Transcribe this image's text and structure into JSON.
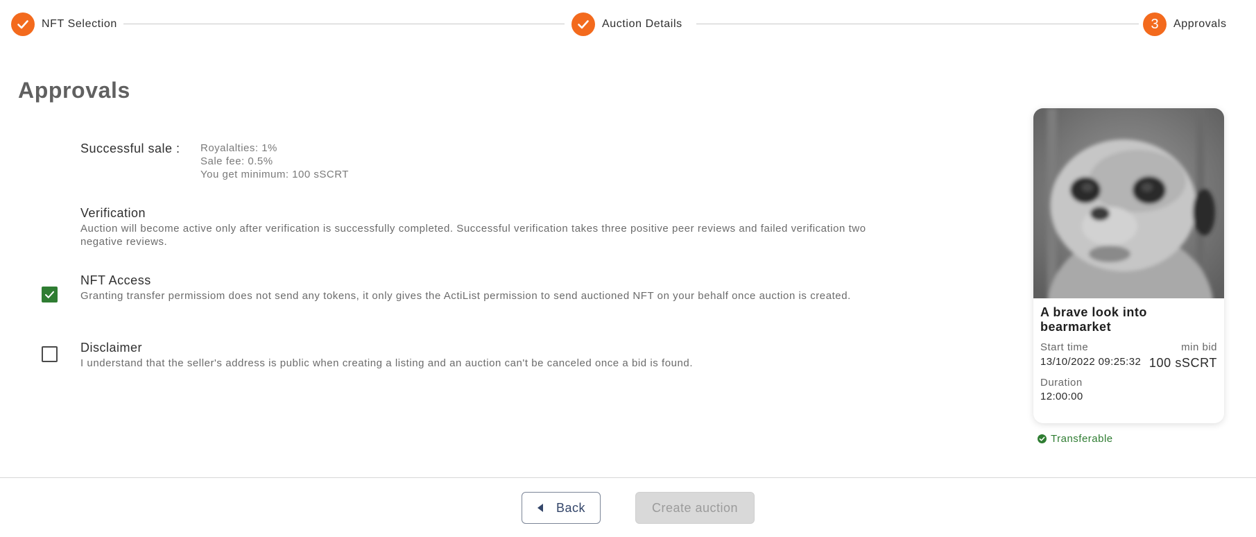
{
  "stepper": {
    "steps": [
      {
        "label": "NFT Selection",
        "state": "done"
      },
      {
        "label": "Auction Details",
        "state": "done"
      },
      {
        "label": "Approvals",
        "state": "current",
        "number": "3"
      }
    ]
  },
  "page": {
    "title": "Approvals"
  },
  "sale": {
    "label": "Successful sale :",
    "royalties": "Royalalties: 1%",
    "fee": "Sale fee: 0.5%",
    "minimum": "You get minimum: 100 sSCRT"
  },
  "verification": {
    "title": "Verification",
    "description": "Auction will become active only after verification is successfully completed. Successful verification takes three positive peer reviews and failed verification two negative reviews."
  },
  "nft_access": {
    "title": "NFT Access",
    "description": "Granting transfer permissiom does not send any tokens, it only gives the ActiList permission to send auctioned NFT on your behalf once auction is created.",
    "checked": true
  },
  "disclaimer": {
    "title": "Disclaimer",
    "description": "I understand that the seller's address is public when creating a listing and an auction can't be canceled once a bid is found.",
    "checked": false
  },
  "card": {
    "title": "A brave look into bearmarket",
    "start_label": "Start time",
    "start_value": "13/10/2022 09:25:32",
    "bid_label": "min bid",
    "bid_value": "100 sSCRT",
    "duration_label": "Duration",
    "duration_value": "12:00:00"
  },
  "status": {
    "transferable": "Transferable"
  },
  "footer": {
    "back_label": "Back",
    "create_label": "Create auction"
  },
  "colors": {
    "accent": "#f36a1d",
    "success": "#2f7d32",
    "disabled": "#d9d9d9"
  },
  "icons": {
    "step_done": "check-icon",
    "back": "caret-left-icon",
    "status": "check-circle-icon"
  }
}
